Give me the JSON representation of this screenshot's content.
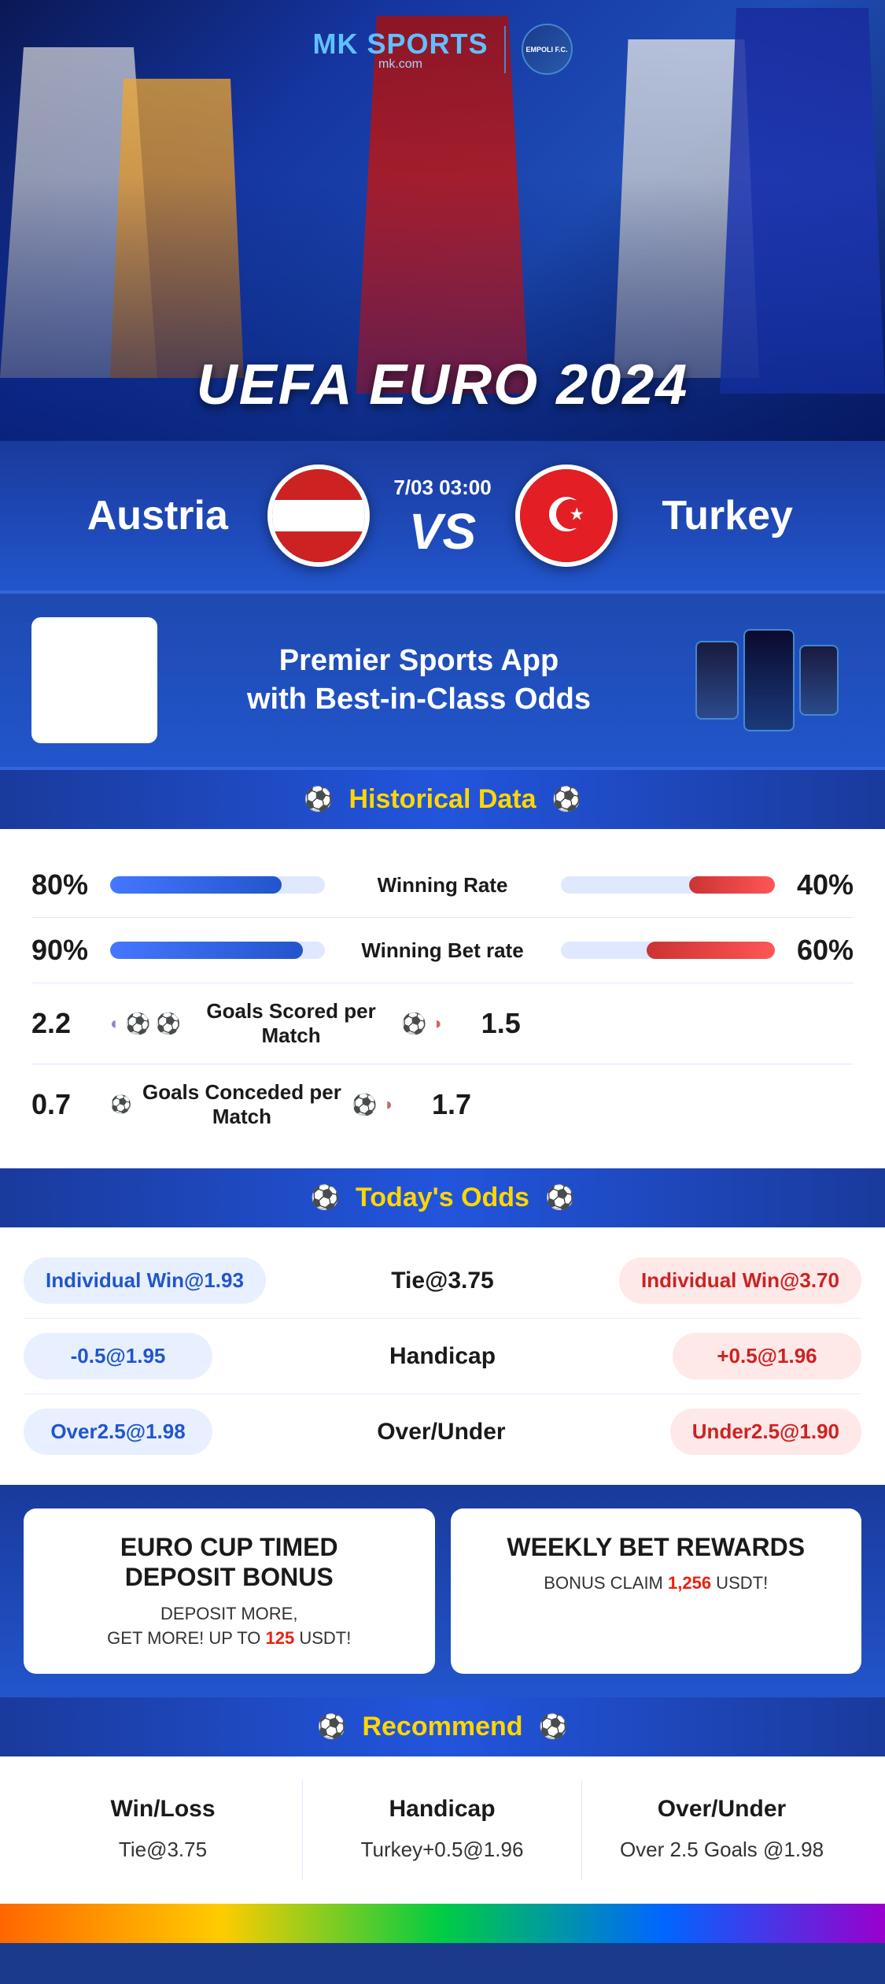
{
  "brand": {
    "name": "MK",
    "sports": "SPORTS",
    "domain": "mk.com",
    "partner": "EMPOLI F.C."
  },
  "hero": {
    "title": "UEFA EURO 2024"
  },
  "match": {
    "team_left": "Austria",
    "team_right": "Turkey",
    "date": "7/03 03:00",
    "vs": "VS"
  },
  "promo": {
    "title": "Premier Sports App\nwith Best-in-Class Odds"
  },
  "historical": {
    "section_title": "Historical Data",
    "stats": [
      {
        "label": "Winning Rate",
        "left_value": "80%",
        "right_value": "40%",
        "left_pct": 80,
        "right_pct": 40
      },
      {
        "label": "Winning Bet rate",
        "left_value": "90%",
        "right_value": "60%",
        "left_pct": 90,
        "right_pct": 60
      },
      {
        "label": "Goals Scored per Match",
        "left_value": "2.2",
        "right_value": "1.5",
        "left_pct": null,
        "right_pct": null
      },
      {
        "label": "Goals Conceded per Match",
        "left_value": "0.7",
        "right_value": "1.7",
        "left_pct": null,
        "right_pct": null
      }
    ]
  },
  "odds": {
    "section_title": "Today's Odds",
    "rows": [
      {
        "left": "Individual Win@1.93",
        "center": "Tie@3.75",
        "right": "Individual Win@3.70",
        "left_color": "blue",
        "right_color": "red"
      },
      {
        "left": "-0.5@1.95",
        "center": "Handicap",
        "right": "+0.5@1.96",
        "left_color": "blue",
        "right_color": "red"
      },
      {
        "left": "Over2.5@1.98",
        "center": "Over/Under",
        "right": "Under2.5@1.90",
        "left_color": "blue",
        "right_color": "red"
      }
    ]
  },
  "bonus": {
    "left_title": "EURO CUP TIMED DEPOSIT BONUS",
    "left_desc": "DEPOSIT MORE, GET MORE! UP TO",
    "left_amount": "125",
    "left_currency": "USDT!",
    "right_title": "WEEKLY BET REWARDS",
    "right_desc": "BONUS CLAIM",
    "right_amount": "1,256",
    "right_currency": "USDT!"
  },
  "recommend": {
    "section_title": "Recommend",
    "cols": [
      {
        "title": "Win/Loss",
        "value": "Tie@3.75"
      },
      {
        "title": "Handicap",
        "value": "Turkey+0.5@1.96"
      },
      {
        "title": "Over/Under",
        "value": "Over 2.5 Goals @1.98"
      }
    ]
  },
  "icons": {
    "soccer_ball": "⚽",
    "crescent": "☪"
  }
}
